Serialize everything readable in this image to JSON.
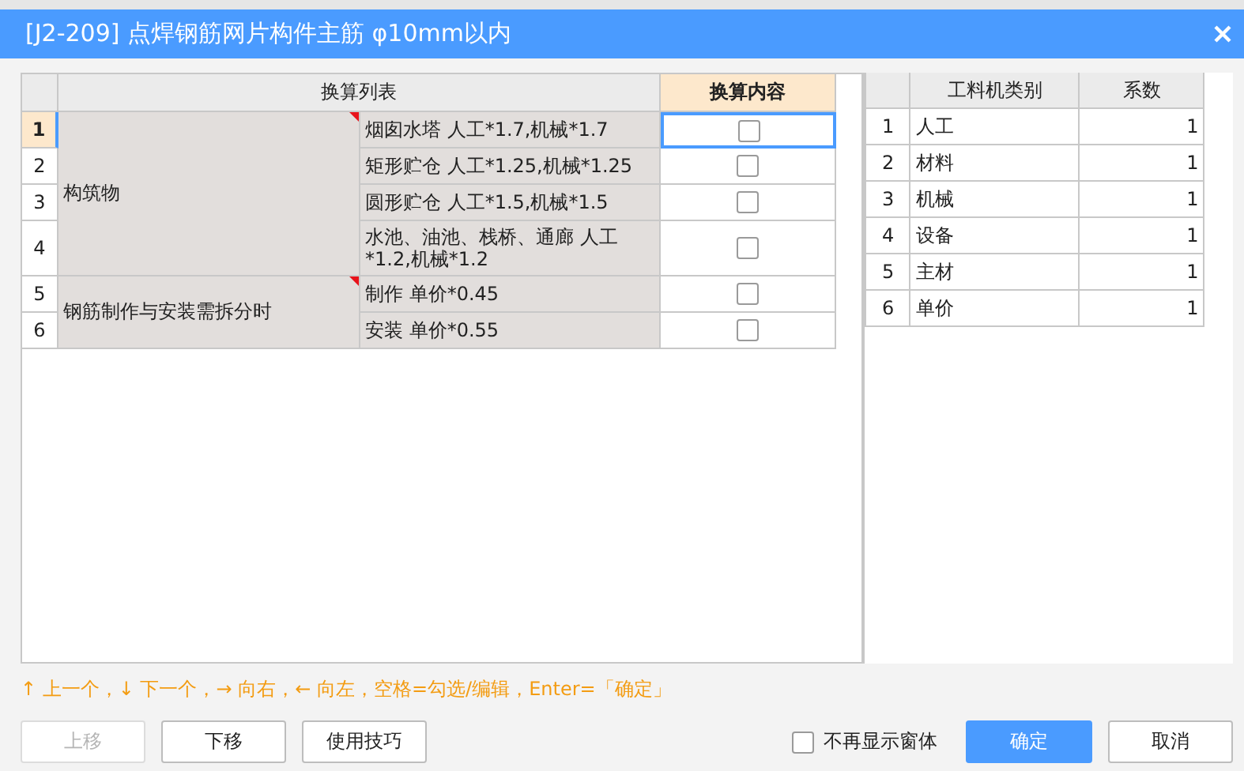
{
  "window": {
    "title": "[J2-209] 点焊钢筋网片构件主筋 φ10mm以内"
  },
  "conversion_table": {
    "columns": [
      "换算列表",
      "换算内容"
    ],
    "groups": [
      {
        "label": "构筑物",
        "has_note": true,
        "rows": [
          {
            "number": "1",
            "text": "烟囱水塔 人工*1.7,机械*1.7",
            "checked": false,
            "selected": true
          },
          {
            "number": "2",
            "text": "矩形贮仓 人工*1.25,机械*1.25",
            "checked": false,
            "selected": false
          },
          {
            "number": "3",
            "text": "圆形贮仓 人工*1.5,机械*1.5",
            "checked": false,
            "selected": false
          },
          {
            "number": "4",
            "text": "水池、油池、栈桥、通廊 人工*1.2,机械*1.2",
            "checked": false,
            "selected": false
          }
        ]
      },
      {
        "label": "钢筋制作与安装需拆分时",
        "has_note": true,
        "rows": [
          {
            "number": "5",
            "text": "制作 单价*0.45",
            "checked": false,
            "selected": false
          },
          {
            "number": "6",
            "text": "安装 单价*0.55",
            "checked": false,
            "selected": false
          }
        ]
      }
    ]
  },
  "coefficient_table": {
    "columns": [
      "工料机类别",
      "系数"
    ],
    "rows": [
      {
        "number": "1",
        "category": "人工",
        "value": "1"
      },
      {
        "number": "2",
        "category": "材料",
        "value": "1"
      },
      {
        "number": "3",
        "category": "机械",
        "value": "1"
      },
      {
        "number": "4",
        "category": "设备",
        "value": "1"
      },
      {
        "number": "5",
        "category": "主材",
        "value": "1"
      },
      {
        "number": "6",
        "category": "单价",
        "value": "1"
      }
    ]
  },
  "hint": "↑ 上一个，↓ 下一个，→ 向右，← 向左，空格=勾选/编辑，Enter=「确定」",
  "left_buttons": [
    {
      "label": "上移",
      "disabled": true
    },
    {
      "label": "下移",
      "disabled": false
    },
    {
      "label": "使用技巧",
      "disabled": false
    }
  ],
  "dont_show_again": {
    "label": "不再显示窗体",
    "checked": false
  },
  "right_buttons": [
    {
      "label": "确定",
      "kind": "primary"
    },
    {
      "label": "取消",
      "kind": "default"
    }
  ]
}
